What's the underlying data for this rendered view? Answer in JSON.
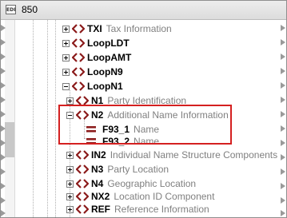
{
  "window": {
    "title": "850",
    "title_icon": "EDI"
  },
  "rows": [
    {
      "name": "TXI",
      "desc": "Tax Information"
    },
    {
      "name": "LoopLDT",
      "desc": ""
    },
    {
      "name": "LoopAMT",
      "desc": ""
    },
    {
      "name": "LoopN9",
      "desc": ""
    },
    {
      "name": "LoopN1",
      "desc": ""
    },
    {
      "name": "N1",
      "desc": "Party Identification"
    },
    {
      "name": "N2",
      "desc": "Additional Name Information"
    },
    {
      "name": "F93_1",
      "desc": "Name"
    },
    {
      "name": "F93_2",
      "desc": "Name"
    },
    {
      "name": "IN2",
      "desc": "Individual Name Structure Components"
    },
    {
      "name": "N3",
      "desc": "Party Location"
    },
    {
      "name": "N4",
      "desc": "Geographic Location"
    },
    {
      "name": "NX2",
      "desc": "Location ID Component"
    },
    {
      "name": "REF",
      "desc": "Reference Information"
    }
  ],
  "colors": {
    "segment_icon": "#8b1a1a",
    "highlight": "#d42020",
    "description": "#808080"
  }
}
